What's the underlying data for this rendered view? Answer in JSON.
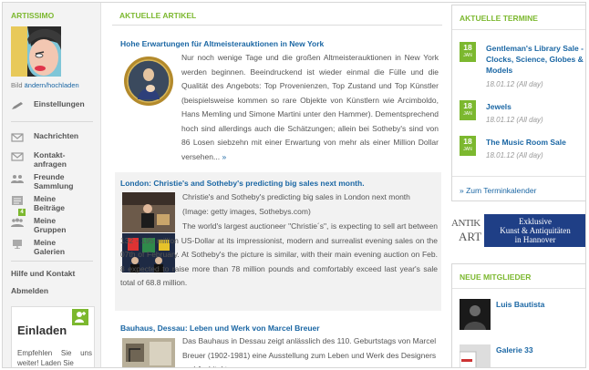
{
  "sidebar": {
    "username": "ARTISSIMO",
    "avatar_caption_prefix": "Bild",
    "avatar_caption_link": "ändern/hochladen",
    "items": [
      {
        "label": "Einstellungen",
        "icon": "pencil-icon"
      },
      {
        "label": "Nachrichten",
        "icon": "envelope-icon"
      },
      {
        "label": "Kontakt-\nanfragen",
        "icon": "contact-request-icon"
      },
      {
        "label": "Freunde\nSammlung",
        "icon": "friends-icon"
      },
      {
        "label": "Meine\nBeiträge",
        "icon": "posts-icon"
      },
      {
        "label": "Meine\nGruppen",
        "icon": "groups-icon"
      },
      {
        "label": "Meine\nGalerien",
        "icon": "gallery-icon"
      }
    ],
    "groups_badge": "4",
    "help_label": "Hilfe und Kontakt",
    "logout_label": "Abmelden",
    "invite": {
      "title": "Einladen",
      "text": "Empfehlen Sie uns weiter! Laden Sie"
    }
  },
  "main": {
    "section_title": "AKTUELLE ARTIKEL",
    "articles": [
      {
        "title": "Hohe Erwartungen für Altmeisterauktionen in New York",
        "body_intro": "Nur noch wenige Tage und die großen Altmeisterauktionen in New York werden beginnen. Beeindruckend ist wieder einmal die Fülle und die Qualität des Angebots: Top Provenienzen, Top Zustand und Top Künstler (beispielsweise kommen so rare Objekte von Künstlern wie Arcimboldo, Hans Memling und Simone Martini unter den Hammer). Dementsprechend hoch sind allerdings auch die Schätzungen; allein bei Sotheby's sind von 86 Losen siebzehn mit einer Erwartung von mehr als einer Million Dollar versehen...",
        "more": "»"
      },
      {
        "title": "London: Christie's and Sotheby's predicting big sales next month.",
        "caption": "Christie's and Sotheby's predicting big sales in London next month (Image: getty images, Sothebys.com)",
        "body": "The world's largest auctioneer \"Christie´s\", is expecting to sell art between 132 - 195 million US-Dollar at its impressionist, modern and surrealist evening sales on the 07th of February. At Sotheby's the picture is similar, with their main evening auction on Feb. 8 expected to raise more than 78 million pounds and comfortably exceed last year's sale total of 68.8 million."
      },
      {
        "title": "Bauhaus, Dessau: Leben und Werk von Marcel Breuer",
        "body_intro": "Das Bauhaus in Dessau zeigt anlässlich des 110. Geburtstags von Marcel Breuer (1902-1981) eine Ausstellung zum Leben und Werk des Designers und Architekten."
      }
    ]
  },
  "right": {
    "events_title": "AKTUELLE TERMINE",
    "events": [
      {
        "day": "18",
        "month": "JAN",
        "title": "Gentleman's Library Sale - Clocks, Science, Globes & Models",
        "meta": "18.01.12 (All day)"
      },
      {
        "day": "18",
        "month": "JAN",
        "title": "Jewels",
        "meta": "18.01.12 (All day)"
      },
      {
        "day": "18",
        "month": "JAN",
        "title": "The Music Room Sale",
        "meta": "18.01.12 (All day)"
      }
    ],
    "calendar_link": "» Zum Terminkalender",
    "ad": {
      "logo_top": "ANTIK",
      "logo_bottom": "ART",
      "line1": "Exklusive",
      "line2": "Kunst & Antiquitäten",
      "line3": "in Hannover"
    },
    "members_title": "NEUE MITGLIEDER",
    "members": [
      {
        "name": "Luis Bautista"
      },
      {
        "name": "Galerie 33"
      }
    ]
  },
  "colors": {
    "accent_green": "#7cb82f",
    "link_blue": "#1b67a4",
    "ad_blue": "#1f3f86"
  }
}
